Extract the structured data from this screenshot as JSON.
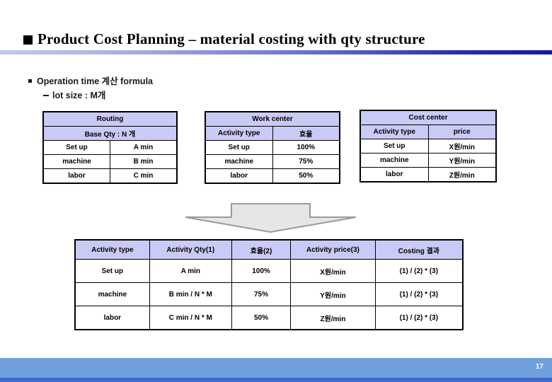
{
  "slide": {
    "title": "Product Cost Planning – material costing with qty structure",
    "bullet_1": "Operation time 계산 formula",
    "bullet_2": "lot size : M개",
    "page_number": "17",
    "colors": {
      "table_header_fill": "#c9caf6",
      "footer_band": "#6f9fdd",
      "footer_strip": "#4068d0",
      "rule_gradient_left": "#c3c8ee",
      "rule_gradient_right": "#151a9b",
      "arrow_fill": "#e6e6e6",
      "arrow_border": "#9a9a9a"
    }
  },
  "tables": {
    "routing": {
      "title": "Routing",
      "subtitle": "Base Qty : N 개",
      "rows": [
        [
          "Set up",
          "A min"
        ],
        [
          "machine",
          "B min"
        ],
        [
          "labor",
          "C min"
        ]
      ]
    },
    "work_center": {
      "title": "Work center",
      "headers": [
        "Activity type",
        "효율"
      ],
      "rows": [
        [
          "Set up",
          "100%"
        ],
        [
          "machine",
          "75%"
        ],
        [
          "labor",
          "50%"
        ]
      ]
    },
    "cost_center": {
      "title": "Cost center",
      "headers": [
        "Activity type",
        "price"
      ],
      "rows": [
        [
          "Set up",
          "X원/min"
        ],
        [
          "machine",
          "Y원/min"
        ],
        [
          "labor",
          "Z원/min"
        ]
      ]
    },
    "result": {
      "headers": [
        "Activity type",
        "Activity Qty(1)",
        "효율(2)",
        "Activity price(3)",
        "Costing 결과"
      ],
      "rows": [
        [
          "Set up",
          "A min",
          "100%",
          "X원/min",
          "(1) / (2) * (3)"
        ],
        [
          "machine",
          "B min /  N * M",
          "75%",
          "Y원/min",
          "(1) / (2) * (3)"
        ],
        [
          "labor",
          "C min /  N * M",
          "50%",
          "Z원/min",
          "(1) / (2) * (3)"
        ]
      ]
    }
  },
  "arrow": {
    "name": "down-arrow"
  }
}
